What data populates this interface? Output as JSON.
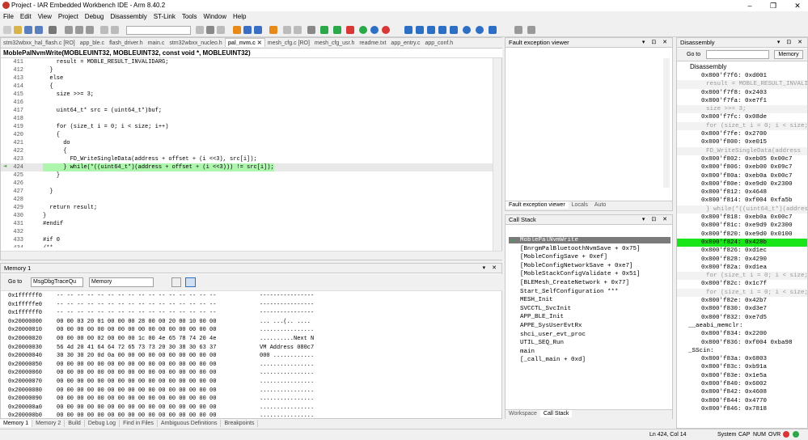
{
  "window": {
    "title": "Project - IAR Embedded Workbench IDE - Arm 8.40.2",
    "minimize": "–",
    "maximize": "❐",
    "close": "✕"
  },
  "menu": [
    "File",
    "Edit",
    "View",
    "Project",
    "Debug",
    "Disassembly",
    "ST-Link",
    "Tools",
    "Window",
    "Help"
  ],
  "toolbar": {
    "colors": {
      "green": "#2ba84a",
      "red": "#d93636",
      "blue": "#2d6fc4",
      "orange": "#e88a1a",
      "gray": "#888888"
    }
  },
  "editor": {
    "tabs": [
      "stm32wbxx_hal_flash.c [RO]",
      "app_ble.c",
      "flash_driver.h",
      "main.c",
      "stm32wbxx_nucleo.h",
      "pal_nvm.c",
      "mesh_cfg.c [RO]",
      "mesh_cfg_usr.h",
      "readme.txt",
      "app_entry.c",
      "app_conf.h"
    ],
    "active_tab": "pal_nvm.c",
    "tab_close": "✕",
    "function": "MoblePalNvmWrite(MOBLEUINT32, MOBLEUINT32, const void *, MOBLEUINT32)",
    "lines": [
      {
        "n": "411",
        "t": "    result = MOBLE_RESULT_INVALIDARG;"
      },
      {
        "n": "412",
        "t": "  }"
      },
      {
        "n": "413",
        "t": "  else"
      },
      {
        "n": "414",
        "t": "  {"
      },
      {
        "n": "415",
        "t": "    size >>= 3;"
      },
      {
        "n": "416",
        "t": ""
      },
      {
        "n": "417",
        "t": "    uint64_t* src = (uint64_t*)buf;"
      },
      {
        "n": "418",
        "t": ""
      },
      {
        "n": "419",
        "t": "    for (size_t i = 0; i < size; i++)"
      },
      {
        "n": "420",
        "t": "    {"
      },
      {
        "n": "421",
        "t": "      do"
      },
      {
        "n": "422",
        "t": "      {"
      },
      {
        "n": "423",
        "t": "        FD_WriteSingleData(address + offset + (i <<3), src[i]);"
      },
      {
        "n": "424",
        "t": "      } while(*((uint64_t*)(address + offset + (i <<3))) != src[i]);"
      },
      {
        "n": "425",
        "t": "    }"
      },
      {
        "n": "426",
        "t": ""
      },
      {
        "n": "427",
        "t": "  }"
      },
      {
        "n": "428",
        "t": ""
      },
      {
        "n": "429",
        "t": "  return result;"
      },
      {
        "n": "430",
        "t": "}"
      },
      {
        "n": "431",
        "t": "#endif"
      },
      {
        "n": "432",
        "t": ""
      },
      {
        "n": "433",
        "t": "#if 0"
      },
      {
        "n": "434",
        "t": "/**"
      }
    ],
    "current_line": "424"
  },
  "memory": {
    "title": "Memory 1",
    "goto_label": "Go to",
    "goto_value": "MsgDbgTraceQu",
    "zone": "Memory",
    "rows": [
      {
        "a": "0x1ffffff0",
        "h": "-- -- -- -- -- -- -- -- -- -- -- -- -- -- -- --",
        "s": "----------------"
      },
      {
        "a": "0x1fffffe0",
        "h": "-- -- -- -- -- -- -- -- -- -- -- -- -- -- -- --",
        "s": "----------------"
      },
      {
        "a": "0x1ffffff0",
        "h": "-- -- -- -- -- -- -- -- -- -- -- -- -- -- -- --",
        "s": "----------------"
      },
      {
        "a": "0x20000000",
        "h": "00 00 03 20 01 00 00 00 28 00 00 20 00 10 00 00",
        "s": "... ...(.. ...."
      },
      {
        "a": "0x20000010",
        "h": "00 00 00 00 00 00 00 00 00 00 00 00 00 00 00 00",
        "s": "................"
      },
      {
        "a": "0x20000020",
        "h": "00 00 00 00 02 00 00 00 1c 00 4e 65 78 74 20 4e",
        "s": "..........Next N"
      },
      {
        "a": "0x20000030",
        "h": "56 4d 20 41 64 64 72 65 73 73 20 30 38 30 63 37",
        "s": "VM Address 080c7"
      },
      {
        "a": "0x20000040",
        "h": "30 30 30 20 0d 0a 00 00 00 00 00 00 00 00 00 00",
        "s": "000 ............"
      },
      {
        "a": "0x20000050",
        "h": "00 00 00 00 00 00 00 00 00 00 00 00 00 00 00 00",
        "s": "................"
      },
      {
        "a": "0x20000060",
        "h": "00 00 00 00 00 00 00 00 00 00 00 00 00 00 00 00",
        "s": "................"
      },
      {
        "a": "0x20000070",
        "h": "00 00 00 00 00 00 00 00 00 00 00 00 00 00 00 00",
        "s": "................"
      },
      {
        "a": "0x20000080",
        "h": "00 00 00 00 00 00 00 00 00 00 00 00 00 00 00 00",
        "s": "................"
      },
      {
        "a": "0x20000090",
        "h": "00 00 00 00 00 00 00 00 00 00 00 00 00 00 00 00",
        "s": "................"
      },
      {
        "a": "0x200000a0",
        "h": "00 00 00 00 00 00 00 00 00 00 00 00 00 00 00 00",
        "s": "................"
      },
      {
        "a": "0x200000b0",
        "h": "00 00 00 00 00 00 00 00 00 00 00 00 00 00 00 00",
        "s": "................"
      }
    ]
  },
  "bottom_tabs": [
    "Memory 1",
    "Memory 2",
    "Build",
    "Debug Log",
    "Find in Files",
    "Ambiguous Definitions",
    "Breakpoints"
  ],
  "fault": {
    "title": "Fault exception viewer",
    "tabs": [
      "Fault exception viewer",
      "Locals",
      "Auto"
    ]
  },
  "callstack": {
    "title": "Call Stack",
    "frames": [
      "MoblePalNvmWrite",
      "[BnrgmPalBluetoothNvmSave + 0x75]",
      "[MobleConfigSave + 0xef]",
      "[MobleConfigNetworkSave + 0xe7]",
      "[MobleStackConfigValidate + 0x51]",
      "[BLEMesh_CreateNetwork + 0x77]",
      "Start_SelfConfiguration ***",
      "MESH_Init",
      "SVCCTL_SvcInit",
      "APP_BLE_Init",
      "APPE_SysUserEvtRx",
      "shci_user_evt_proc",
      "UTIL_SEQ_Run",
      "main",
      "[_call_main + 0xd]"
    ],
    "tabs": [
      "Workspace",
      "Call Stack"
    ]
  },
  "disassembly": {
    "title": "Disassembly",
    "goto_label": "Go to",
    "memory_button": "Memory",
    "header": "Disassembly",
    "lines": [
      {
        "t": "0x800'f7f6: 0xd001",
        "k": "i"
      },
      {
        "t": "result = MOBLE_RESULT_INVALIDARG;",
        "k": "s"
      },
      {
        "t": "0x800'f7f8: 0x2403",
        "k": "i"
      },
      {
        "t": "0x800'f7fa: 0xe7f1",
        "k": "i"
      },
      {
        "t": "size >>= 3;",
        "k": "s"
      },
      {
        "t": "0x800'f7fc: 0x08de",
        "k": "i"
      },
      {
        "t": "for (size_t i = 0; i < size; i++)",
        "k": "s"
      },
      {
        "t": "0x800'f7fe: 0x2700",
        "k": "i"
      },
      {
        "t": "0x800'f800: 0xe015",
        "k": "i"
      },
      {
        "t": "FD_WriteSingleData(address",
        "k": "s"
      },
      {
        "t": "0x800'f802: 0xeb05 0x00c7",
        "k": "i"
      },
      {
        "t": "0x800'f806: 0xeb00 0x09c7",
        "k": "i"
      },
      {
        "t": "0x800'f80a: 0xeb0a 0x00c7",
        "k": "i"
      },
      {
        "t": "0x800'f80e: 0xe9d0 0x2300",
        "k": "i"
      },
      {
        "t": "0x800'f812: 0x4648",
        "k": "i"
      },
      {
        "t": "0x800'f814: 0xf004 0xfa5b",
        "k": "i"
      },
      {
        "t": "} while(*((uint64_t*)(address",
        "k": "s"
      },
      {
        "t": "0x800'f818: 0xeb0a 0x00c7",
        "k": "i"
      },
      {
        "t": "0x800'f81c: 0xe9d9 0x2300",
        "k": "i"
      },
      {
        "t": "0x800'f820: 0xe9d0 0x0100",
        "k": "i"
      },
      {
        "t": "0x800'f824: 0x428b",
        "k": "c"
      },
      {
        "t": "0x800'f826: 0xd1ec",
        "k": "i"
      },
      {
        "t": "0x800'f828: 0x4290",
        "k": "i"
      },
      {
        "t": "0x800'f82a: 0xd1ea",
        "k": "i"
      },
      {
        "t": "for (size_t i = 0; i < size; i++)",
        "k": "s"
      },
      {
        "t": "0x800'f82c: 0x1c7f",
        "k": "i"
      },
      {
        "t": "for (size_t i = 0; i < size; i++)",
        "k": "s"
      },
      {
        "t": "0x800'f82e: 0x42b7",
        "k": "i"
      },
      {
        "t": "0x800'f830: 0xd3e7",
        "k": "i"
      },
      {
        "t": "0x800'f832: 0xe7d5",
        "k": "i"
      },
      {
        "t": "__aeabi_memclr:",
        "k": "l"
      },
      {
        "t": "0x800'f834: 0x2200",
        "k": "i"
      },
      {
        "t": "0x800'f836: 0xf004 0xba98",
        "k": "i"
      },
      {
        "t": "_SScin:",
        "k": "l"
      },
      {
        "t": "0x800'f83a: 0x6803",
        "k": "i"
      },
      {
        "t": "0x800'f83c: 0xb91a",
        "k": "i"
      },
      {
        "t": "0x800'f83e: 0x1e5a",
        "k": "i"
      },
      {
        "t": "0x800'f840: 0x6002",
        "k": "i"
      },
      {
        "t": "0x800'f842: 0x4608",
        "k": "i"
      },
      {
        "t": "0x800'f844: 0x4770",
        "k": "i"
      },
      {
        "t": "0x800'f846: 0x7818",
        "k": "i"
      }
    ]
  },
  "status": {
    "position": "Ln 424, Col 14",
    "system": "System",
    "caps": "CAP",
    "num": "NUM",
    "ovr": "OVR"
  }
}
